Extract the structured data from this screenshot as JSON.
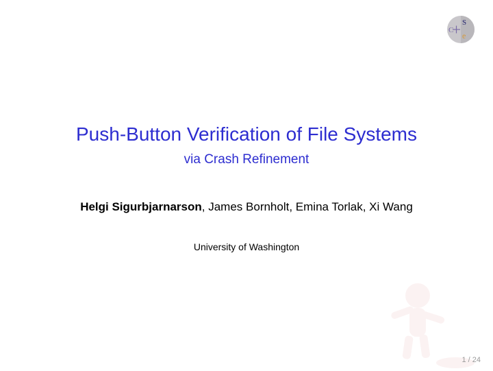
{
  "title": "Push-Button Verification of File Systems",
  "subtitle": "via Crash Refinement",
  "lead_author": "Helgi Sigurbjarnarson",
  "other_authors": ", James Bornholt, Emina Torlak, Xi Wang",
  "affiliation": "University of Washington",
  "page_current": "1",
  "page_sep": " / ",
  "page_total": "24",
  "logo_letter_s": "S",
  "logo_letter_c": "C",
  "logo_letter_e": "e"
}
